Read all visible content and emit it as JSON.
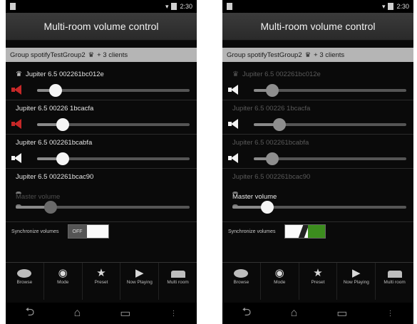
{
  "screens": [
    {
      "status": {
        "time": "2:30"
      },
      "title": "Multi-room volume control",
      "group": {
        "name": "Group spotifyTestGroup2",
        "clients": "+ 3 clients"
      },
      "clients": [
        {
          "name": "Jupiter 6.5 002261bc012e",
          "master": true,
          "muted": true,
          "volume": 0.12,
          "dim": false
        },
        {
          "name": "Jupiter 6.5 00226 1bcacfa",
          "master": false,
          "muted": true,
          "volume": 0.17,
          "dim": false
        },
        {
          "name": "Jupiter 6.5 002261bcabfa",
          "master": false,
          "muted": false,
          "volume": 0.17,
          "dim": false
        },
        {
          "name": "Jupiter 6.5 002261bcac90",
          "master": false,
          "muted": false,
          "volume": null,
          "dim": false
        }
      ],
      "master": {
        "label": "Master volume",
        "volume": 0.2,
        "active": false
      },
      "sync": {
        "label": "Synchronize volumes",
        "toggle": "OFF"
      },
      "nav": [
        {
          "label": "Browse",
          "icon": "cloud-icon"
        },
        {
          "label": "Mode",
          "icon": "mode-icon"
        },
        {
          "label": "Preset",
          "icon": "star-icon"
        },
        {
          "label": "Now Playing",
          "icon": "play-icon"
        },
        {
          "label": "Multi room",
          "icon": "sofa-icon"
        }
      ]
    },
    {
      "status": {
        "time": "2:30"
      },
      "title": "Multi-room volume control",
      "group": {
        "name": "Group spotifyTestGroup2",
        "clients": "+ 3 clients"
      },
      "clients": [
        {
          "name": "Jupiter 6.5 002261bc012e",
          "master": true,
          "muted": false,
          "volume": 0.12,
          "dim": true
        },
        {
          "name": "Jupiter 6.5 00226 1bcacfa",
          "master": false,
          "muted": false,
          "volume": 0.17,
          "dim": true
        },
        {
          "name": "Jupiter 6.5 002261bcabfa",
          "master": false,
          "muted": false,
          "volume": 0.12,
          "dim": true
        },
        {
          "name": "Jupiter 6.5 002261bcac90",
          "master": false,
          "muted": false,
          "volume": null,
          "dim": true
        }
      ],
      "master": {
        "label": "Master volume",
        "volume": 0.2,
        "active": true
      },
      "sync": {
        "label": "Synchronize volumes",
        "toggle": ""
      },
      "nav": [
        {
          "label": "Browse",
          "icon": "cloud-icon"
        },
        {
          "label": "Mode",
          "icon": "mode-icon"
        },
        {
          "label": "Preset",
          "icon": "star-icon"
        },
        {
          "label": "Now Playing",
          "icon": "play-icon"
        },
        {
          "label": "Multi room",
          "icon": "sofa-icon"
        }
      ]
    }
  ]
}
